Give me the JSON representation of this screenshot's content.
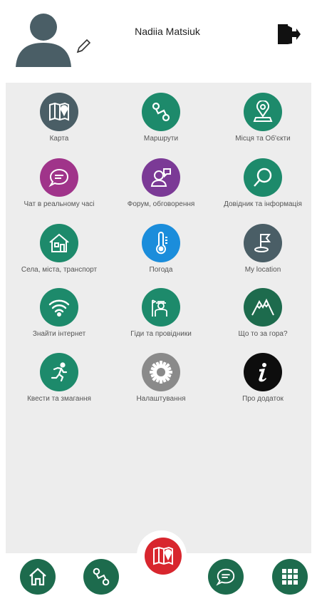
{
  "header": {
    "user_name": "Nadiia Matsiuk"
  },
  "menu": [
    {
      "label": "Карта",
      "icon": "map-pin-icon",
      "color": "#4a5e66"
    },
    {
      "label": "Маршрути",
      "icon": "route-icon",
      "color": "#1d8a6b"
    },
    {
      "label": "Місця та Об'єкти",
      "icon": "place-marker-icon",
      "color": "#1d8a6b"
    },
    {
      "label": "Чат в реальному часі",
      "icon": "chat-icon",
      "color": "#a0348a"
    },
    {
      "label": "Форум, обговорення",
      "icon": "forum-user-icon",
      "color": "#7b3a96"
    },
    {
      "label": "Довідник та інформація",
      "icon": "search-icon",
      "color": "#1d8a6b"
    },
    {
      "label": "Села, міста, транспорт",
      "icon": "house-icon",
      "color": "#1d8a6b"
    },
    {
      "label": "Погода",
      "icon": "thermometer-icon",
      "color": "#1b8ddb"
    },
    {
      "label": "My location",
      "icon": "flag-location-icon",
      "color": "#4a5e66"
    },
    {
      "label": "Знайти інтернет",
      "icon": "wifi-icon",
      "color": "#1d8a6b"
    },
    {
      "label": "Гіди та провідники",
      "icon": "guide-icon",
      "color": "#1d8a6b"
    },
    {
      "label": "Що то за гора?",
      "icon": "mountain-icon",
      "color": "#1d6b4d"
    },
    {
      "label": "Квести та змагання",
      "icon": "runner-icon",
      "color": "#1d8a6b"
    },
    {
      "label": "Налаштування",
      "icon": "gear-icon",
      "color": "#8a8a8a"
    },
    {
      "label": "Про додаток",
      "icon": "info-icon",
      "color": "#0d0d0d"
    }
  ],
  "bottom_nav": [
    {
      "icon": "home-icon"
    },
    {
      "icon": "route-icon"
    },
    {
      "icon": "map-pin-icon"
    },
    {
      "icon": "chat-icon"
    },
    {
      "icon": "grid-menu-icon"
    }
  ]
}
